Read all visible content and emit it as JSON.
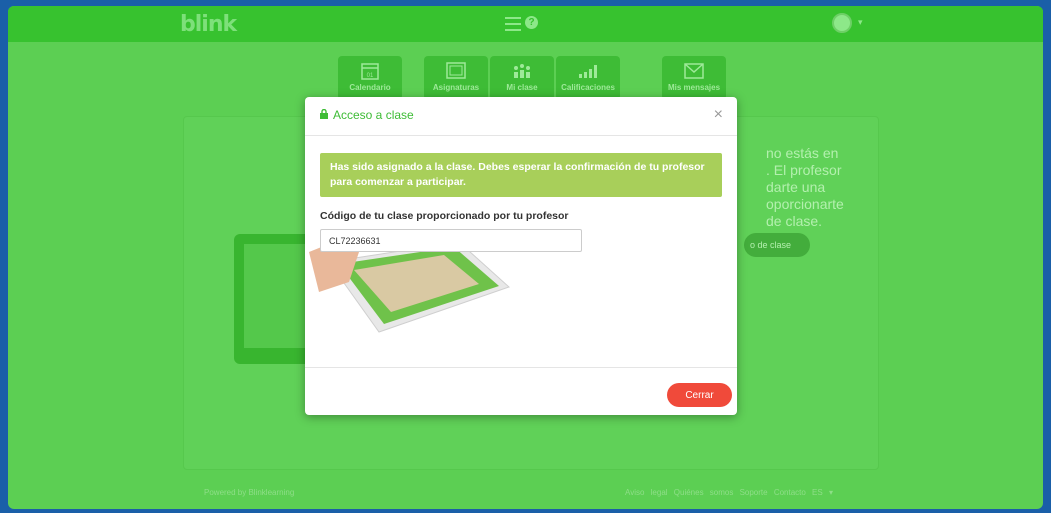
{
  "app": {
    "logo": "blink",
    "help_glyph": "?",
    "caret": "▾"
  },
  "nav": {
    "tiles": [
      {
        "label": "Calendario",
        "badge": "01",
        "icon": "calendar-icon"
      },
      {
        "label": "Asignaturas",
        "icon": "book-icon"
      },
      {
        "label": "Mi clase",
        "icon": "people-icon"
      },
      {
        "label": "Calificaciones",
        "icon": "bar-chart-icon"
      },
      {
        "label": "Mis mensajes",
        "icon": "envelope-icon"
      }
    ]
  },
  "background": {
    "text_lines": [
      "no estás en",
      ". El profesor",
      "darte una",
      "oporcionarte",
      "de clase."
    ],
    "button": "o de clase"
  },
  "footer": {
    "powered": "Powered by Blinklearning",
    "links": "Aviso legal  Quiénes somos  Soporte  Contacto  ES ▾"
  },
  "modal": {
    "title": "Acceso a clase",
    "close_glyph": "×",
    "alert": "Has sido asignado a la clase. Debes esperar la confirmación de tu profesor para comenzar a participar.",
    "field_label": "Código de tu clase proporcionado por tu profesor",
    "code_value": "CL72236631",
    "close_button": "Cerrar"
  },
  "colors": {
    "accent": "#3ebc36",
    "alert_bg": "#a8cf5a",
    "danger": "#f04a3a"
  }
}
